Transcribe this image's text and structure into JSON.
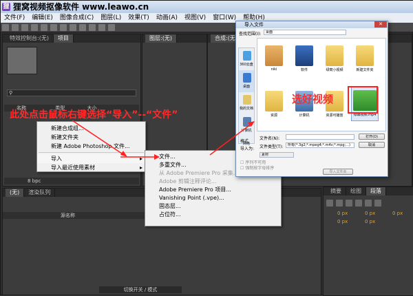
{
  "window": {
    "title": "狸窝视频抠像软件 www.leawo.cn"
  },
  "menu": [
    "文件(F)",
    "编辑(E)",
    "图像合成(C)",
    "图层(L)",
    "效果(T)",
    "动画(A)",
    "视图(V)",
    "窗口(W)",
    "帮助(H)"
  ],
  "panels": {
    "top_left_tabs": [
      "特效控制台:(无)",
      "项目"
    ],
    "top_mid_tabs": [
      "图层:(无)"
    ],
    "top_right_tabs": [
      "合成:(无)"
    ],
    "project_columns": [
      "名称",
      "类型",
      "大小"
    ],
    "project_bpc": "8 bpc",
    "timeline_tabs": [
      "(无)",
      "渲染队列"
    ],
    "timeline_col": "源名称",
    "bottom_button": "切换开关 / 模式",
    "right_tabs": [
      "摘要",
      "绘图",
      "段落"
    ],
    "px_values": [
      "0 px",
      "0 px",
      "0 px",
      "0 px",
      "0 px"
    ]
  },
  "context_menu": {
    "items": [
      "新建合成组...",
      "新建文件夹",
      "新建 Adobe Photoshop 文件...",
      "导入",
      "导入最近使用素材"
    ]
  },
  "submenu": {
    "items": [
      "文件...",
      "多重文件...",
      "从 Adobe Premiere Pro 采集...",
      "Adobe 剪辑注释评论...",
      "Adobe Premiere Pro 项目...",
      "Vanishing Point (.vpe)...",
      "固态层...",
      "占位符..."
    ]
  },
  "dialog": {
    "title": "导入文件",
    "lookin_label": "查找范围(I):",
    "lookin_value": "桌面",
    "sidebar": [
      "360云盘",
      "桌面",
      "我的文档",
      "计算机",
      "网络"
    ],
    "files": [
      "niki",
      "软件",
      "绿窝小视频",
      "新建文件夹",
      "资源",
      "计算机",
      "资源可播放",
      "绿幕视频.mp4"
    ],
    "filename_label": "文件名(N):",
    "filetype_label": "文件类型(T):",
    "filetype_value": "所有(*.3g2;*.mpeg4;*.m4v;*.mpg;...)",
    "open_button": "打开(O)",
    "cancel_button": "取消",
    "format_label": "格式",
    "import_as_label": "导入为:",
    "import_as_value": "素材",
    "check1": "序列不可用",
    "check2": "强制按字母排序",
    "import_folder_button": "导入文件夹"
  },
  "annotations": {
    "left": "此处点击鼠标右键选择“导入”--“文件”",
    "right": "选好视频"
  }
}
